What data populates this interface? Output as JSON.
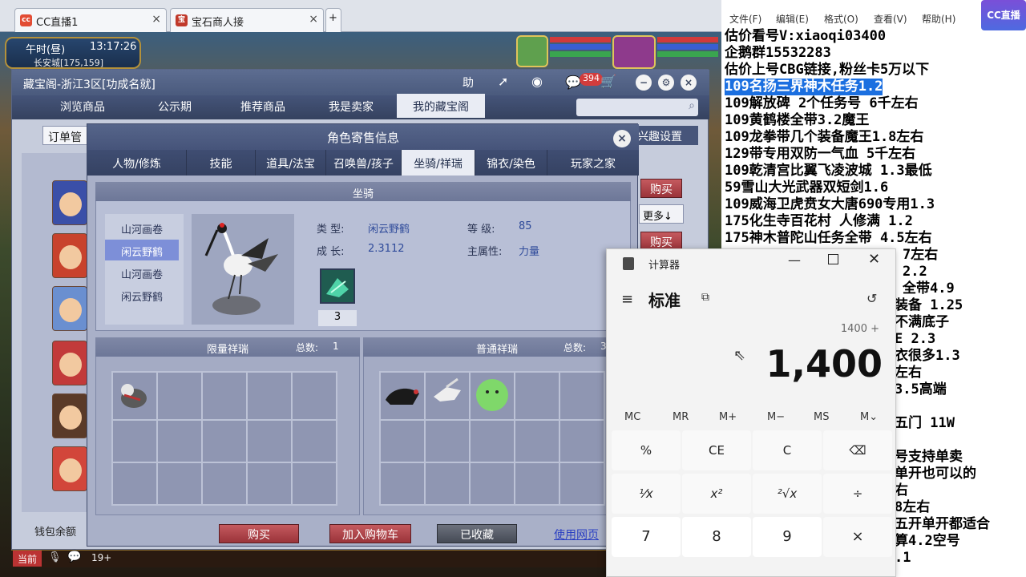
{
  "browser": {
    "tabs": [
      {
        "label": "CC直播1",
        "icon": "cc-live-icon"
      },
      {
        "label": "宝石商人接",
        "icon": "game-icon"
      }
    ],
    "add_tab": "+"
  },
  "game": {
    "time_label": "午时(昼)",
    "clock": "13:17:26",
    "location": "长安城[175,159]",
    "bottom_left": "当前",
    "bottom_count": "19+"
  },
  "cbg": {
    "title": "藏宝阁-浙江3区[功成名就]",
    "title_buttons": [
      "助"
    ],
    "badge": "394",
    "tabs": [
      "浏览商品",
      "公示期",
      "推荐商品",
      "我是卖家",
      "我的藏宝阁"
    ],
    "order_label": "订单管",
    "interest_label": "兴趣设置",
    "buy_label": "购买",
    "more_label": "更多↓",
    "wallet_label": "钱包余额"
  },
  "role": {
    "title": "角色寄售信息",
    "tabs": [
      "人物/修炼",
      "技能",
      "道具/法宝",
      "召唤兽/孩子",
      "坐骑/祥瑞",
      "锦衣/染色",
      "玩家之家"
    ],
    "active_tab": 4,
    "mount_header": "坐骑",
    "mount_list": [
      "山河画卷",
      "闲云野鹤",
      "山河画卷",
      "闲云野鹤"
    ],
    "selected_mount": 1,
    "type_label": "类 型:",
    "type_value": "闲云野鹤",
    "level_label": "等 级:",
    "level_value": "85",
    "growth_label": "成 长:",
    "growth_value": "2.3112",
    "main_attr_label": "主属性:",
    "main_attr_value": "力量",
    "item_count": "3",
    "limited_header": "限量祥瑞",
    "limited_total_label": "总数:",
    "limited_total": "1",
    "normal_header": "普通祥瑞",
    "normal_total_label": "总数:",
    "normal_total": "3",
    "buttons": {
      "buy": "购买",
      "cart": "加入购物车",
      "saved": "已收藏",
      "web": "使用网页"
    }
  },
  "notepad": {
    "menu": [
      "文件(F)",
      "编辑(E)",
      "格式(O)",
      "查看(V)",
      "帮助(H)"
    ],
    "lines": [
      "估价看号V:xiaoqi03400",
      "企鹅群15532283",
      "估价上号CBG链接,粉丝卡5万以下",
      "109名扬三界神木任务1.2",
      "109解放碑 2个任务号 6千左右",
      "109黄鹤楼全带3.2魔王",
      "109龙拳带几个装备魔王1.8左右",
      "129带专用双防一气血 5千左右",
      "109乾清宫比翼飞凌波城 1.3最低",
      "59雪山大光武器双短剑1.6",
      "109威海卫虎贲女大唐690专用1.3",
      "175化生寺百花村 人修满 1.2",
      "175神木普陀山任务全带 4.5左右",
      "7左右",
      "2.2",
      "全带4.9",
      "装备  1.25",
      "不满底子",
      "E 2.3",
      "衣很多1.3",
      "左右",
      "3.5高端",
      "",
      "五门 11W",
      "",
      "号支持单卖",
      "单开也可以的",
      "右",
      "8左右",
      "五开单开都适合",
      "算4.2空号",
      ".1"
    ],
    "highlighted_line": 3,
    "watermark": "CC直播"
  },
  "calculator": {
    "title": "计算器",
    "mode": "标准",
    "expression": "1400 +",
    "display": "1,400",
    "memory": [
      "MC",
      "MR",
      "M+",
      "M−",
      "MS",
      "M⌄"
    ],
    "keys": [
      [
        "%",
        "CE",
        "C",
        "⌫"
      ],
      [
        "⅟x",
        "x²",
        "²√x",
        "÷"
      ],
      [
        "7",
        "8",
        "9",
        "×"
      ]
    ]
  }
}
